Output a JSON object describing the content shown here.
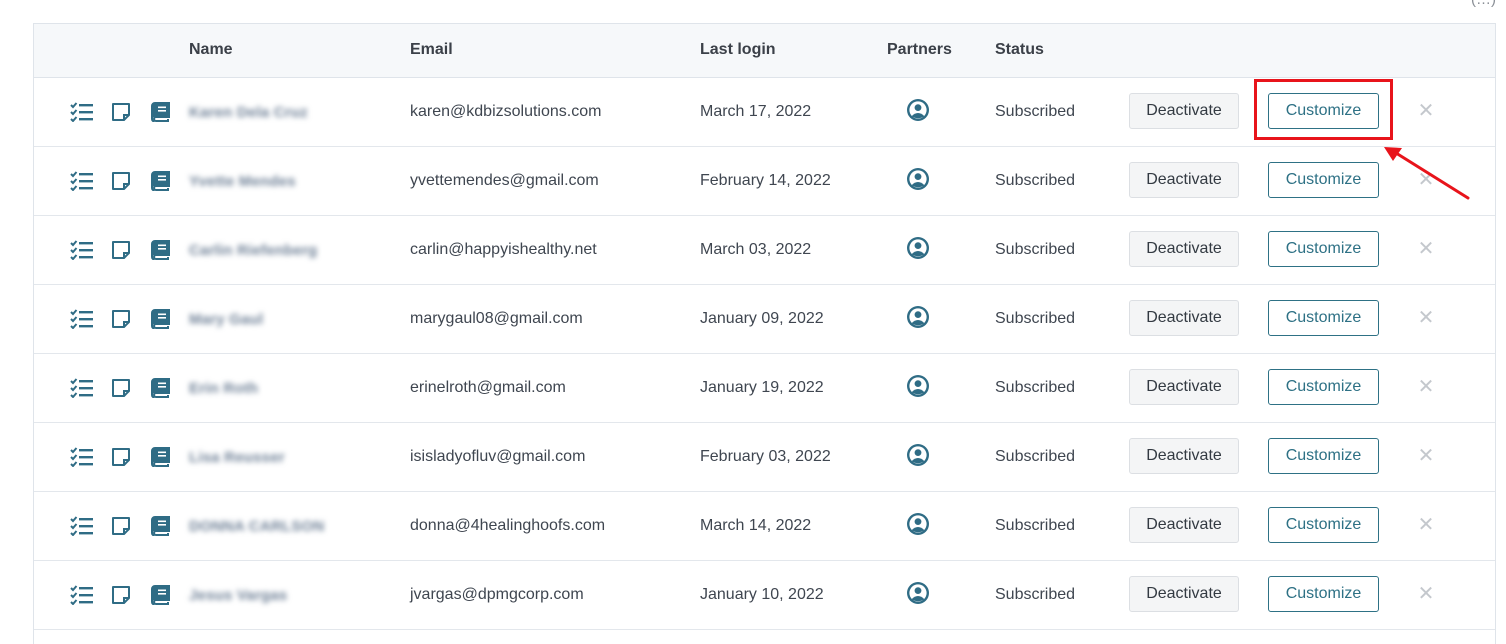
{
  "header_fragment": "(…)",
  "columns": {
    "name": "Name",
    "email": "Email",
    "last_login": "Last login",
    "partners": "Partners",
    "status": "Status"
  },
  "rows": [
    {
      "name": "Karen Dela Cruz",
      "email": "karen@kdbizsolutions.com",
      "last_login": "March 17, 2022",
      "status": "Subscribed",
      "deactivate": "Deactivate",
      "customize": "Customize"
    },
    {
      "name": "Yvette Mendes",
      "email": "yvettemendes@gmail.com",
      "last_login": "February 14, 2022",
      "status": "Subscribed",
      "deactivate": "Deactivate",
      "customize": "Customize"
    },
    {
      "name": "Carlin Riefenberg",
      "email": "carlin@happyishealthy.net",
      "last_login": "March 03, 2022",
      "status": "Subscribed",
      "deactivate": "Deactivate",
      "customize": "Customize"
    },
    {
      "name": "Mary Gaul",
      "email": "marygaul08@gmail.com",
      "last_login": "January 09, 2022",
      "status": "Subscribed",
      "deactivate": "Deactivate",
      "customize": "Customize"
    },
    {
      "name": "Erin Roth",
      "email": "erinelroth@gmail.com",
      "last_login": "January 19, 2022",
      "status": "Subscribed",
      "deactivate": "Deactivate",
      "customize": "Customize"
    },
    {
      "name": "Lisa Reusser",
      "email": "isisladyofluv@gmail.com",
      "last_login": "February 03, 2022",
      "status": "Subscribed",
      "deactivate": "Deactivate",
      "customize": "Customize"
    },
    {
      "name": "DONNA CARLSON",
      "email": "donna@4healinghoofs.com",
      "last_login": "March 14, 2022",
      "status": "Subscribed",
      "deactivate": "Deactivate",
      "customize": "Customize"
    },
    {
      "name": "Jesus Vargas",
      "email": "jvargas@dpmgcorp.com",
      "last_login": "January 10, 2022",
      "status": "Subscribed",
      "deactivate": "Deactivate",
      "customize": "Customize"
    }
  ],
  "icons": {
    "tasks": "checklist-icon",
    "notes": "note-icon",
    "book": "book-icon",
    "partner": "user-circle-icon",
    "remove": "close-icon"
  },
  "colors": {
    "accent": "#2e7185",
    "icon": "#2f6c85",
    "highlight": "#e8141b"
  }
}
